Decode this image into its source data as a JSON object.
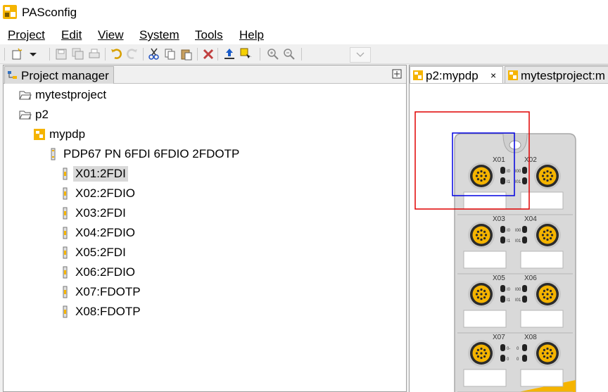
{
  "app": {
    "title": "PASconfig"
  },
  "menu": [
    "Project",
    "Edit",
    "View",
    "System",
    "Tools",
    "Help"
  ],
  "project_manager": {
    "tab_label": "Project manager",
    "tree": [
      {
        "label": "mytestproject",
        "icon": "folder-open-icon"
      },
      {
        "label": "p2",
        "icon": "folder-open-icon"
      },
      {
        "label": "mypdp",
        "icon": "pdp-device-icon"
      },
      {
        "label": "PDP67 PN 6FDI 6FDIO 2FDOTP",
        "icon": "module-icon"
      },
      {
        "label": "X01:2FDI",
        "icon": "port-icon",
        "selected": true
      },
      {
        "label": "X02:2FDIO",
        "icon": "port-icon"
      },
      {
        "label": "X03:2FDI",
        "icon": "port-icon"
      },
      {
        "label": "X04:2FDIO",
        "icon": "port-icon"
      },
      {
        "label": "X05:2FDI",
        "icon": "port-icon"
      },
      {
        "label": "X06:2FDIO",
        "icon": "port-icon"
      },
      {
        "label": "X07:FDOTP",
        "icon": "port-icon"
      },
      {
        "label": "X08:FDOTP",
        "icon": "port-icon"
      }
    ]
  },
  "editor": {
    "tabs": [
      {
        "label": "p2:mypdp",
        "active": true,
        "close": "×"
      },
      {
        "label": "mytestproject:m",
        "active": false
      }
    ],
    "device": {
      "ports": [
        "X01",
        "X02",
        "X03",
        "X04",
        "X05",
        "X06",
        "X07",
        "X08"
      ],
      "leds_left": [
        "I0",
        "I1"
      ],
      "leds_right": [
        "I00",
        "I01"
      ],
      "leds_fdo": [
        "0-",
        "0"
      ]
    }
  },
  "colors": {
    "accent_yellow": "#f5b400",
    "selection_red": "#e00000",
    "selection_blue": "#0000e0",
    "device_body": "#d9d9d9"
  }
}
